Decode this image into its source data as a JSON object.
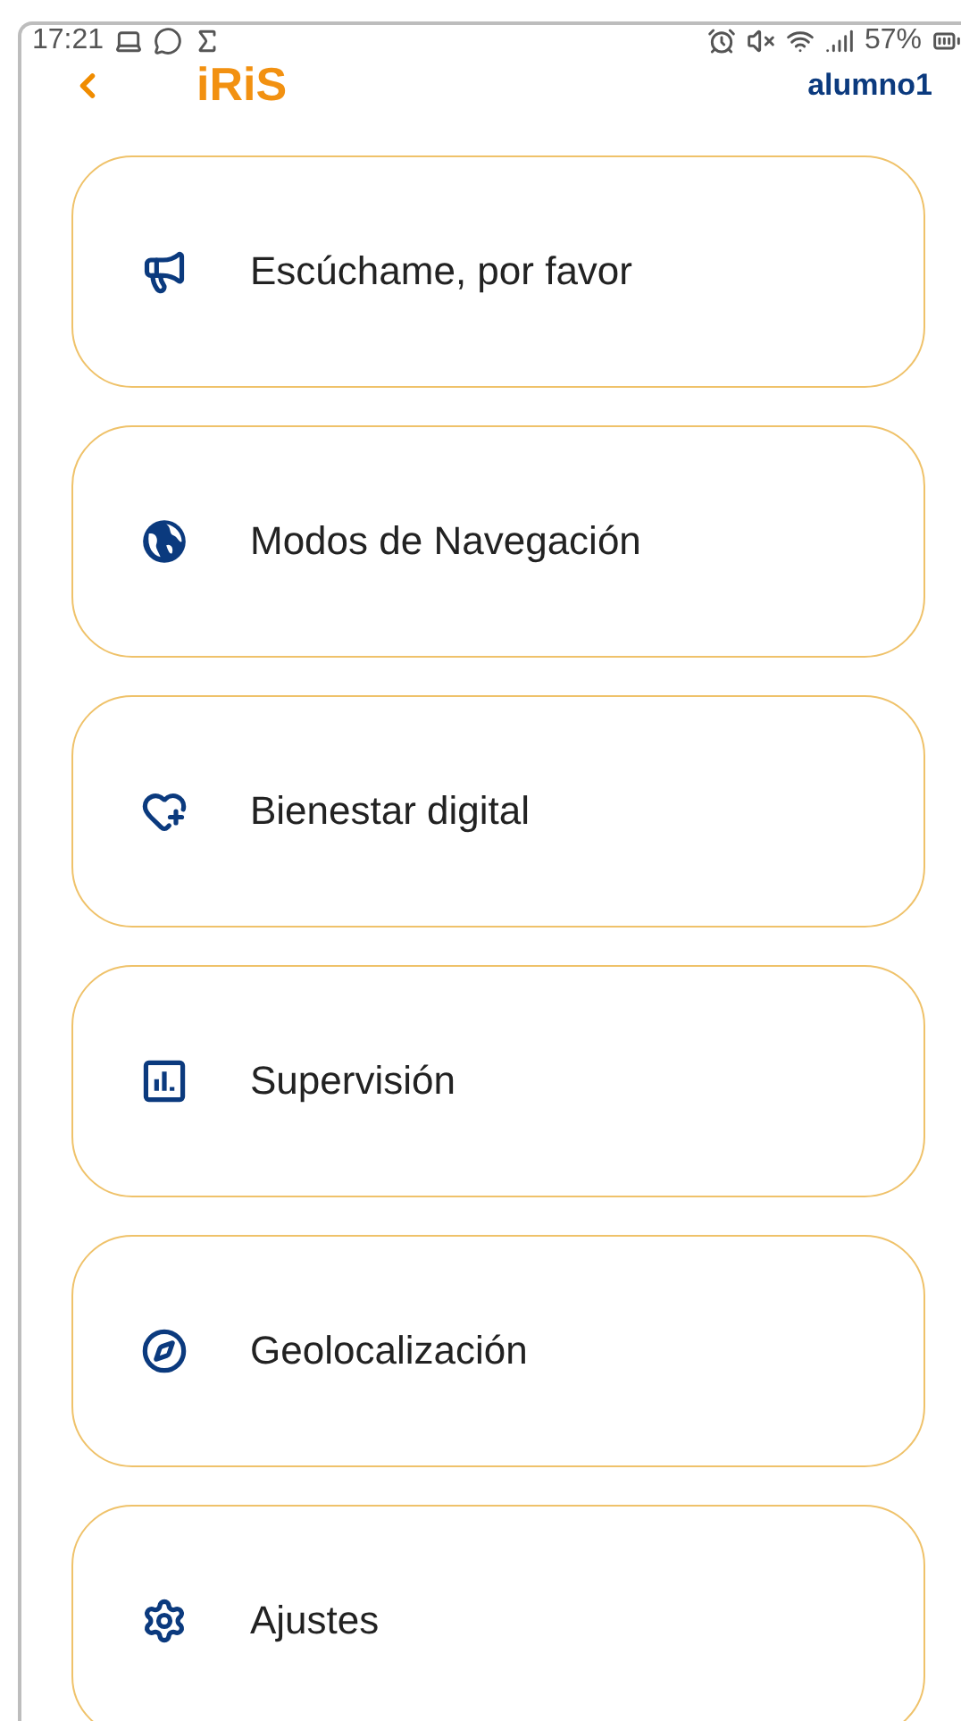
{
  "status_bar": {
    "time": "17:21",
    "battery": "57%"
  },
  "header": {
    "title": "iRiS",
    "user": "alumno1"
  },
  "menu_items": [
    {
      "label": "Escúchame, por favor"
    },
    {
      "label": "Modos de Navegación"
    },
    {
      "label": "Bienestar digital"
    },
    {
      "label": "Supervisión"
    },
    {
      "label": "Geolocalización"
    },
    {
      "label": "Ajustes"
    }
  ]
}
